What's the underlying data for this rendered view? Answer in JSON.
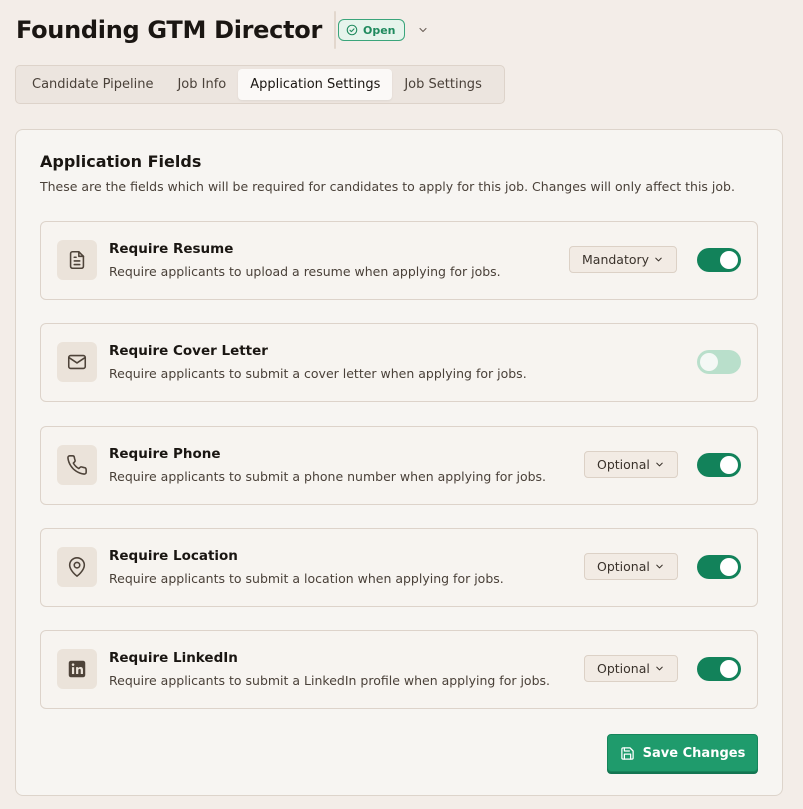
{
  "header": {
    "title": "Founding GTM Director",
    "status": "Open"
  },
  "tabs": [
    {
      "label": "Candidate Pipeline"
    },
    {
      "label": "Job Info"
    },
    {
      "label": "Application Settings"
    },
    {
      "label": "Job Settings"
    }
  ],
  "active_tab": "Application Settings",
  "section": {
    "title": "Application Fields",
    "description": "These are the fields which will be required for candidates to apply for this job. Changes will only affect this job."
  },
  "fields": [
    {
      "title": "Require Resume",
      "description": "Require applicants to upload a resume when applying for jobs.",
      "requirement": "Mandatory",
      "enabled": true,
      "icon": "document-icon"
    },
    {
      "title": "Require Cover Letter",
      "description": "Require applicants to submit a cover letter when applying for jobs.",
      "requirement": null,
      "enabled": false,
      "icon": "mail-icon"
    },
    {
      "title": "Require Phone",
      "description": "Require applicants to submit a phone number when applying for jobs.",
      "requirement": "Optional",
      "enabled": true,
      "icon": "phone-icon"
    },
    {
      "title": "Require Location",
      "description": "Require applicants to submit a location when applying for jobs.",
      "requirement": "Optional",
      "enabled": true,
      "icon": "map-pin-icon"
    },
    {
      "title": "Require LinkedIn",
      "description": "Require applicants to submit a LinkedIn profile when applying for jobs.",
      "requirement": "Optional",
      "enabled": true,
      "icon": "linkedin-icon"
    }
  ],
  "save_button": {
    "label": "Save Changes",
    "icon": "save-icon"
  },
  "colors": {
    "accent": "#12825a",
    "background": "#f3ede8",
    "status_green": "#1f8a5e"
  }
}
